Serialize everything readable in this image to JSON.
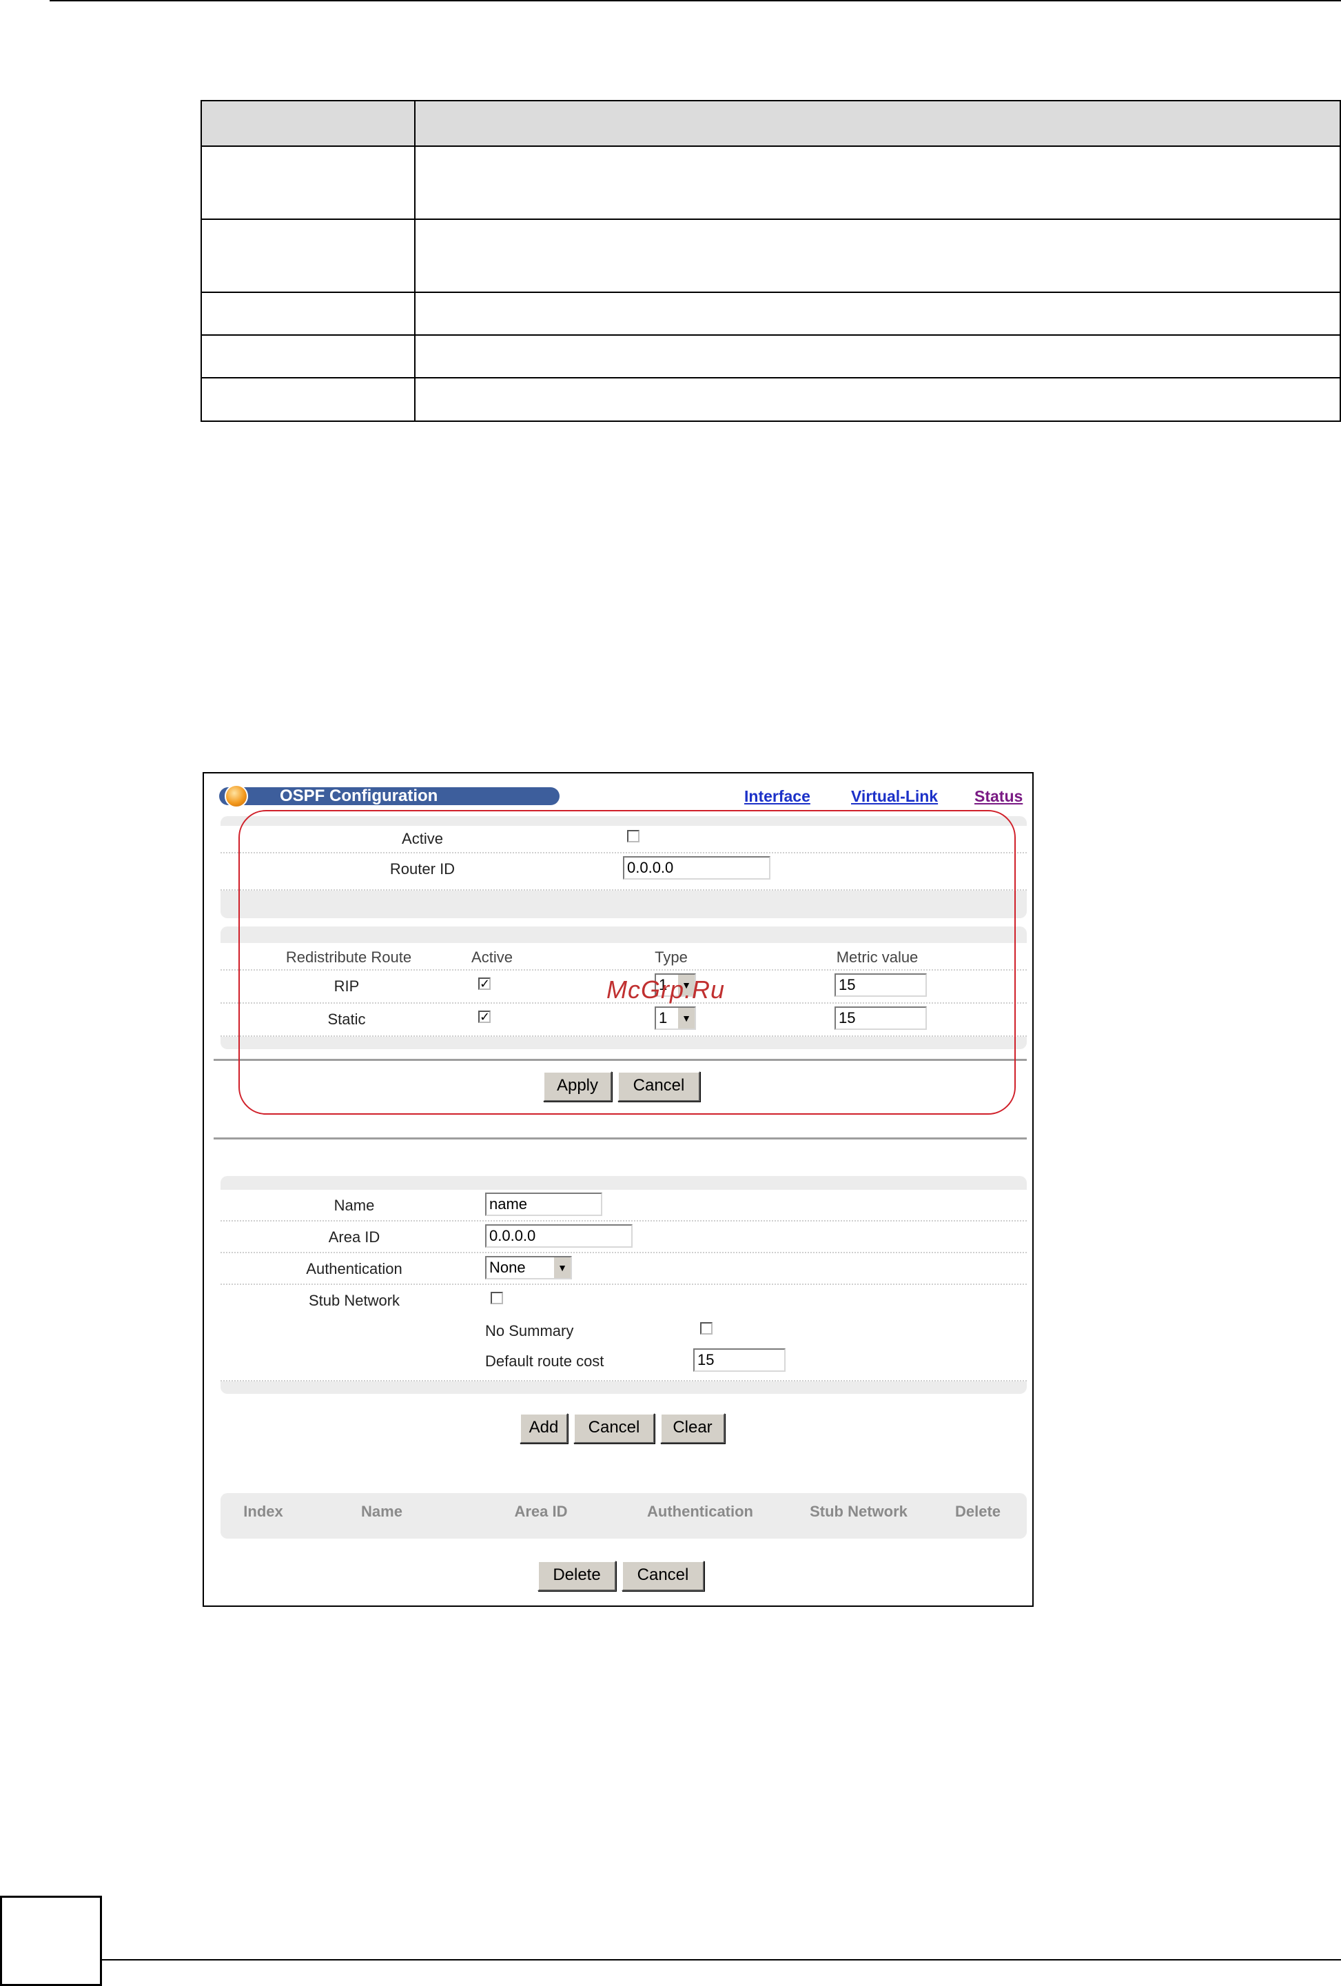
{
  "ospf": {
    "title": "OSPF Configuration",
    "links": {
      "interface": "Interface",
      "virtual_link": "Virtual-Link",
      "status": "Status"
    },
    "general": {
      "active_label": "Active",
      "router_id_label": "Router ID",
      "router_id_value": "0.0.0.0"
    },
    "redistribute": {
      "headers": {
        "route": "Redistribute Route",
        "active": "Active",
        "type": "Type",
        "metric": "Metric value"
      },
      "rows": [
        {
          "name": "RIP",
          "active": "✓",
          "type": "1",
          "metric": "15"
        },
        {
          "name": "Static",
          "active": "✓",
          "type": "1",
          "metric": "15"
        }
      ]
    },
    "buttons": {
      "apply": "Apply",
      "cancel": "Cancel"
    },
    "area": {
      "name_label": "Name",
      "name_value": "name",
      "area_id_label": "Area ID",
      "area_id_value": "0.0.0.0",
      "auth_label": "Authentication",
      "auth_value": "None",
      "stub_label": "Stub Network",
      "no_summary_label": "No Summary",
      "default_cost_label": "Default route cost",
      "default_cost_value": "15"
    },
    "area_buttons": {
      "add": "Add",
      "cancel": "Cancel",
      "clear": "Clear"
    },
    "list_headers": [
      "Index",
      "Name",
      "Area ID",
      "Authentication",
      "Stub Network",
      "Delete"
    ],
    "list_buttons": {
      "delete": "Delete",
      "cancel": "Cancel"
    }
  },
  "watermark": "McGrp.Ru"
}
